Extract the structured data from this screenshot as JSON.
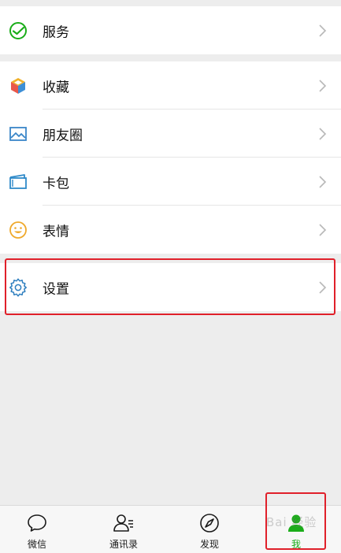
{
  "groups": {
    "service": {
      "label": "服务"
    },
    "favorites": {
      "label": "收藏"
    },
    "moments": {
      "label": "朋友圈"
    },
    "cards": {
      "label": "卡包"
    },
    "stickers": {
      "label": "表情"
    },
    "settings": {
      "label": "设置"
    }
  },
  "tabs": [
    {
      "label": "微信"
    },
    {
      "label": "通讯录"
    },
    {
      "label": "发现"
    },
    {
      "label": "我"
    }
  ],
  "watermark": {
    "text": "Bai 经验"
  },
  "colors": {
    "accent": "#1aad19",
    "highlight": "#e0202a",
    "background": "#ededed"
  }
}
